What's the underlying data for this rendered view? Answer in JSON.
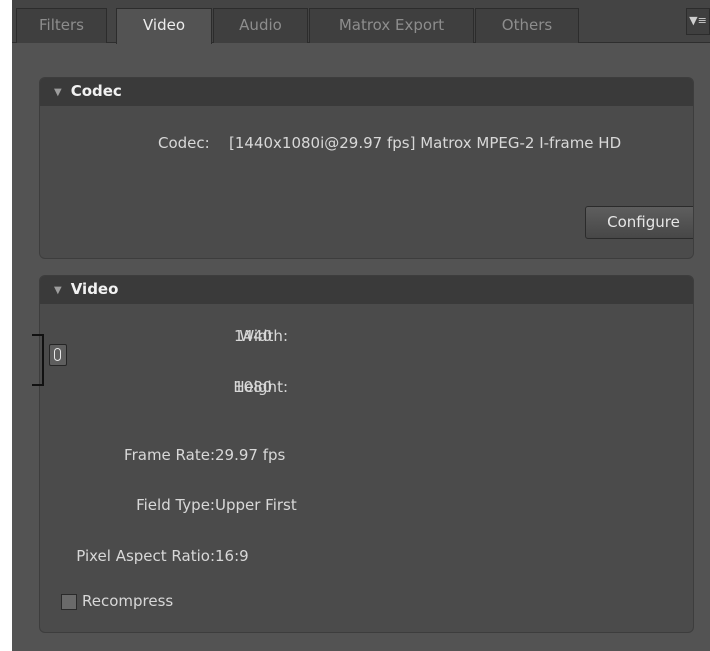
{
  "tabs": [
    {
      "label": "Filters",
      "active": false
    },
    {
      "label": "Video",
      "active": true
    },
    {
      "label": "Audio",
      "active": false
    },
    {
      "label": "Matrox Export",
      "active": false
    },
    {
      "label": "Others",
      "active": false
    }
  ],
  "tab_menu_icon": "panel-menu-icon",
  "codec_section": {
    "title": "Codec",
    "codec_label": "Codec:",
    "codec_value": "[1440x1080i@29.97 fps] Matrox MPEG-2 I-frame HD",
    "configure_label": "Configure"
  },
  "video_section": {
    "title": "Video",
    "width_label": "Width:",
    "width_value": "1440",
    "height_label": "Height:",
    "height_value": "1080",
    "frame_rate_label": "Frame Rate:",
    "frame_rate_value": "29.97 fps",
    "field_type_label": "Field Type:",
    "field_type_value": "Upper First",
    "par_label": "Pixel Aspect Ratio:",
    "par_value": "16:9",
    "recompress_label": "Recompress",
    "recompress_checked": false
  },
  "colors": {
    "panel": "#535353",
    "section": "#4b4b4b",
    "header": "#3a3a3a",
    "text": "#dcdcdc"
  }
}
